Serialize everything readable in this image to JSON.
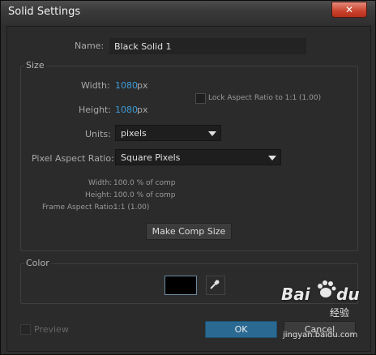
{
  "window": {
    "title": "Solid Settings",
    "close_symbol": "✕"
  },
  "name": {
    "label": "Name:",
    "value": "Black Solid 1"
  },
  "size": {
    "group_title": "Size",
    "width_label": "Width:",
    "width_value": "1080",
    "width_unit": "px",
    "height_label": "Height:",
    "height_value": "1080",
    "height_unit": "px",
    "lock_label": "Lock Aspect Ratio to 1:1 (1.00)",
    "units_label": "Units:",
    "units_value": "pixels",
    "par_label": "Pixel Aspect Ratio:",
    "par_value": "Square Pixels",
    "info_width_label": "Width:",
    "info_width_value": "100.0 % of comp",
    "info_height_label": "Height:",
    "info_height_value": "100.0 % of comp",
    "info_far_label": "Frame Aspect Ratio:",
    "info_far_value": "1:1 (1.00)",
    "make_comp_size_label": "Make Comp Size"
  },
  "color": {
    "group_title": "Color",
    "swatch_color": "#000000"
  },
  "footer": {
    "preview_label": "Preview",
    "ok_label": "OK",
    "cancel_label": "Cancel"
  },
  "watermark": {
    "brand": "Bai",
    "paw": "du",
    "suffix": "经验",
    "url": "jingyan.baidu.com"
  },
  "colors": {
    "accent": "#3d9bd6",
    "ok_button": "#2a6a92"
  }
}
